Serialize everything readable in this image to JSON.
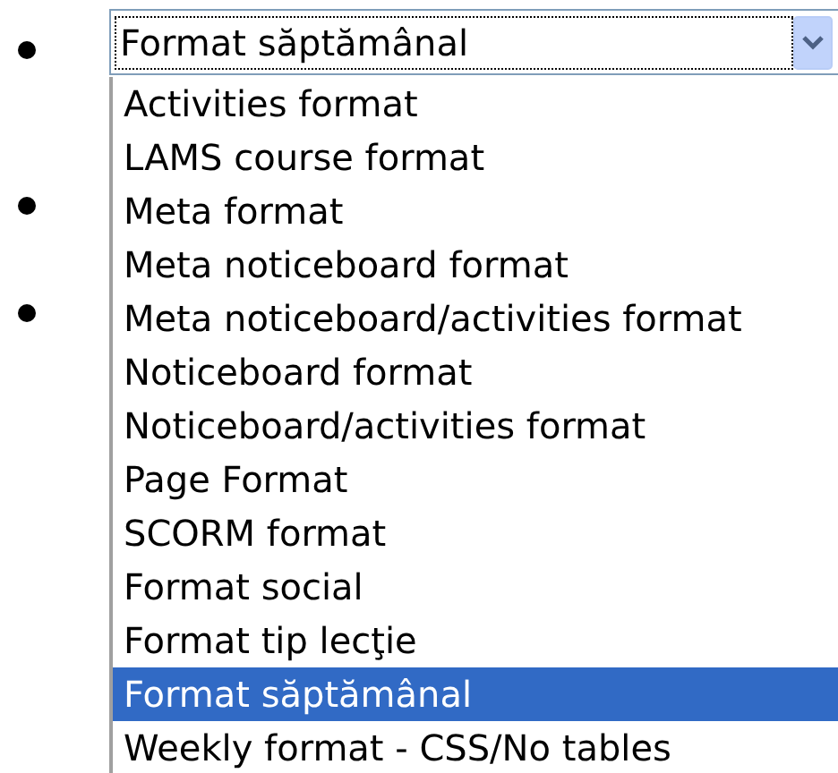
{
  "select": {
    "value": "Format săptămânal"
  },
  "options": [
    {
      "label": "Activities format",
      "selected": false
    },
    {
      "label": "LAMS course format",
      "selected": false
    },
    {
      "label": "Meta format",
      "selected": false
    },
    {
      "label": "Meta noticeboard format",
      "selected": false
    },
    {
      "label": "Meta noticeboard/activities format",
      "selected": false
    },
    {
      "label": "Noticeboard format",
      "selected": false
    },
    {
      "label": "Noticeboard/activities format",
      "selected": false
    },
    {
      "label": "Page Format",
      "selected": false
    },
    {
      "label": "SCORM format",
      "selected": false
    },
    {
      "label": "Format social",
      "selected": false
    },
    {
      "label": "Format tip lecţie",
      "selected": false
    },
    {
      "label": "Format săptămânal",
      "selected": true
    },
    {
      "label": "Weekly format - CSS/No tables",
      "selected": false
    }
  ]
}
